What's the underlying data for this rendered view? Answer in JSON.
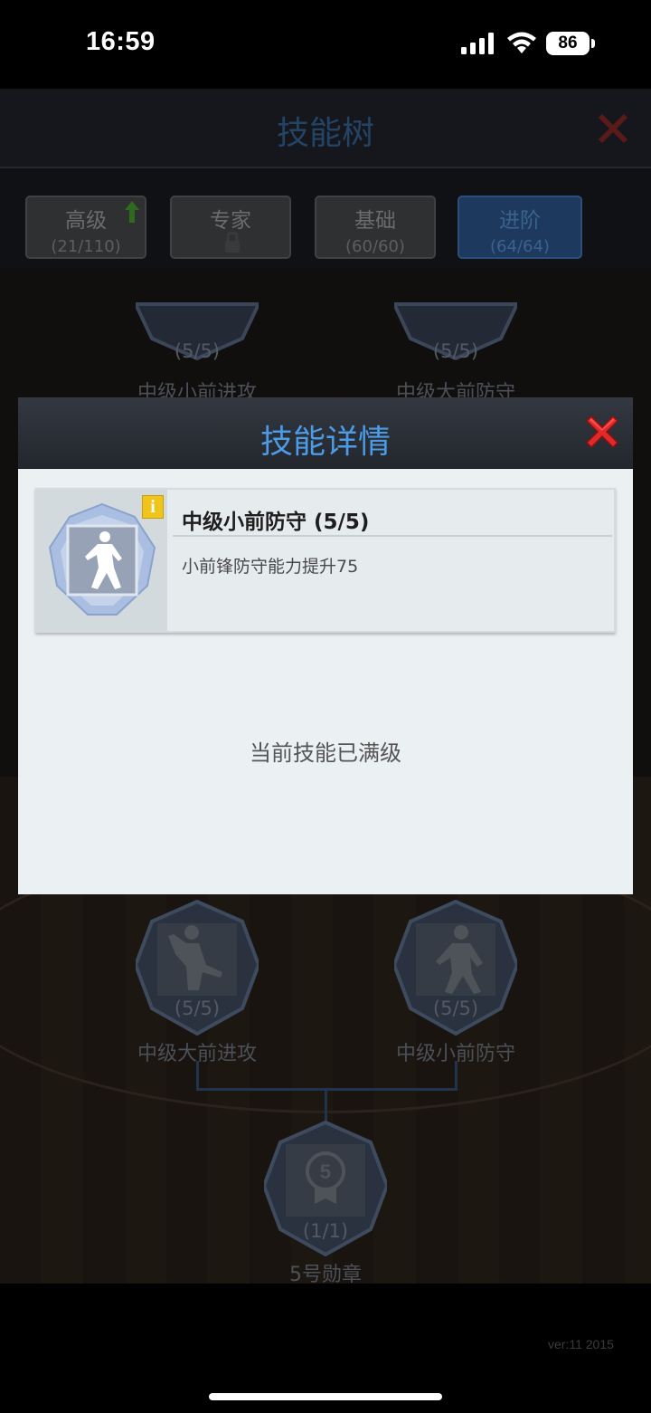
{
  "status_bar": {
    "time": "16:59",
    "battery": "86",
    "icons": [
      "cellular-signal-icon",
      "wifi-icon",
      "battery-icon"
    ]
  },
  "game": {
    "title": "技能树",
    "tabs": [
      {
        "label": "高级",
        "sub": "(21/110)",
        "icon": "upgrade-arrow-icon"
      },
      {
        "label": "专家",
        "sub": "",
        "icon": "lock-icon"
      },
      {
        "label": "基础",
        "sub": "(60/60)"
      },
      {
        "label": "进阶",
        "sub": "(64/64)",
        "active": true
      }
    ],
    "nodes_top": [
      {
        "count": "(5/5)",
        "label": "中级小前进攻"
      },
      {
        "count": "(5/5)",
        "label": "中级大前防守"
      }
    ],
    "nodes_bottom": [
      {
        "count": "(5/5)",
        "label": "中级大前进攻"
      },
      {
        "count": "(5/5)",
        "label": "中级小前防守"
      }
    ],
    "badge_node": {
      "emblem": "5",
      "count": "(1/1)",
      "label": "5号勋章"
    },
    "version": "ver:11  2015"
  },
  "modal": {
    "title": "技能详情",
    "skill": {
      "name": "中级小前防守  (5/5)",
      "description": "小前锋防守能力提升75",
      "info_badge": "i",
      "icon": "defender-silhouette-icon"
    },
    "status_text": "当前技能已满级"
  },
  "colors": {
    "modal_title": "#4d9be6",
    "close_red": "#e02a2a",
    "active_tab": "#1d3a5e",
    "info_badge": "#f0c419"
  }
}
